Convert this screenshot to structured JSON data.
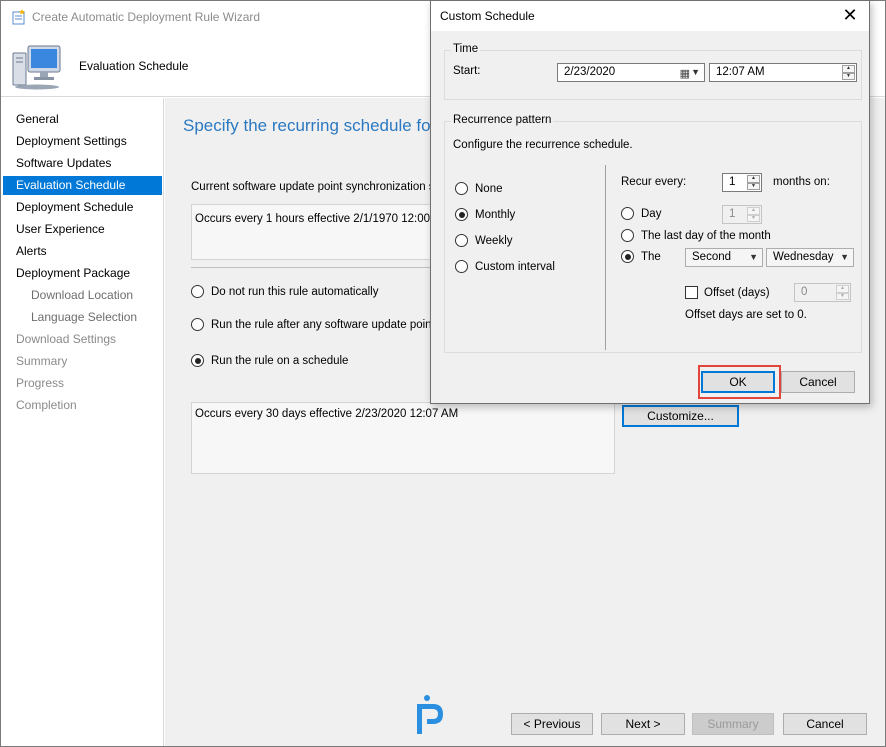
{
  "window": {
    "title": "Create Automatic Deployment Rule Wizard",
    "header": "Evaluation Schedule"
  },
  "sidebar": {
    "items": [
      {
        "label": "General",
        "state": "normal"
      },
      {
        "label": "Deployment Settings",
        "state": "normal"
      },
      {
        "label": "Software Updates",
        "state": "normal"
      },
      {
        "label": "Evaluation Schedule",
        "state": "active"
      },
      {
        "label": "Deployment Schedule",
        "state": "normal"
      },
      {
        "label": "User Experience",
        "state": "normal"
      },
      {
        "label": "Alerts",
        "state": "normal"
      },
      {
        "label": "Deployment Package",
        "state": "normal"
      },
      {
        "label": "Download Location",
        "state": "sub"
      },
      {
        "label": "Language Selection",
        "state": "sub"
      },
      {
        "label": "Download Settings",
        "state": "muted"
      },
      {
        "label": "Summary",
        "state": "muted"
      },
      {
        "label": "Progress",
        "state": "muted"
      },
      {
        "label": "Completion",
        "state": "muted"
      }
    ]
  },
  "main": {
    "title": "Specify the recurring schedule for th",
    "sync_label": "Current software update point synchronization sche",
    "sync_schedule": "Occurs every 1 hours effective 2/1/1970 12:00 A",
    "options": [
      {
        "label": "Do not run this rule automatically",
        "checked": false
      },
      {
        "label": "Run the rule after any software update point sy",
        "checked": false
      },
      {
        "label": "Run the rule on a schedule",
        "checked": true
      }
    ],
    "schedule_text": "Occurs every 30 days effective 2/23/2020 12:07 AM",
    "customize_button": "Customize..."
  },
  "footer": {
    "previous": "< Previous",
    "next": "Next >",
    "summary": "Summary",
    "cancel": "Cancel"
  },
  "dialog": {
    "title": "Custom Schedule",
    "close_glyph": "✕",
    "time_group": "Time",
    "start_label": "Start:",
    "start_date": "2/23/2020",
    "start_time": "12:07 AM",
    "recurrence_group": "Recurrence pattern",
    "recurrence_hint": "Configure the recurrence schedule.",
    "patterns": [
      {
        "label": "None",
        "checked": false
      },
      {
        "label": "Monthly",
        "checked": true
      },
      {
        "label": "Weekly",
        "checked": false
      },
      {
        "label": "Custom interval",
        "checked": false
      }
    ],
    "recur_every_label": "Recur every:",
    "recur_every_value": "1",
    "months_on_label": "months on:",
    "day_label": "Day",
    "day_value": "1",
    "last_day_label": "The last day of the month",
    "the_label": "The",
    "week_selected": "Second",
    "weekday_selected": "Wednesday",
    "offset_label": "Offset (days)",
    "offset_value": "0",
    "offset_note": "Offset days are set to 0.",
    "ok": "OK",
    "cancel": "Cancel"
  },
  "colors": {
    "accent": "#0078d7",
    "title_blue": "#2b79c2",
    "highlight": "#e0463b"
  }
}
